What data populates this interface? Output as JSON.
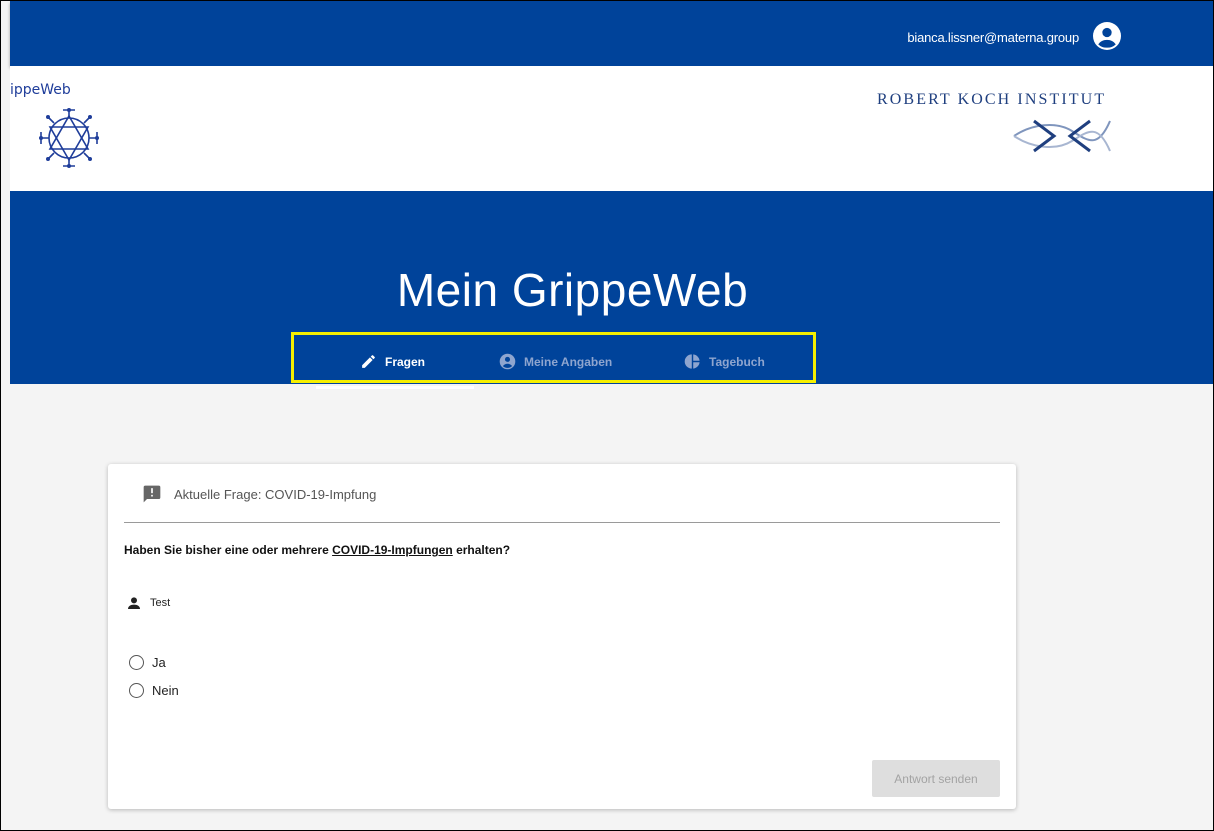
{
  "user": {
    "email": "bianca.lissner@materna.group"
  },
  "logos": {
    "grippeweb_partial": "ippeWeb",
    "rki": "ROBERT KOCH INSTITUT"
  },
  "hero": {
    "title": "Mein GrippeWeb"
  },
  "tabs": [
    {
      "label": "Fragen",
      "icon": "pencil-icon",
      "active": true
    },
    {
      "label": "Meine Angaben",
      "icon": "account-circle-icon",
      "active": false
    },
    {
      "label": "Tagebuch",
      "icon": "pie-chart-icon",
      "active": false
    }
  ],
  "card": {
    "header_label": "Aktuelle Frage: COVID-19-Impfung",
    "question_prefix": "Haben Sie bisher eine oder mehrere ",
    "question_link": "COVID-19-Impfungen",
    "question_suffix": " erhalten?",
    "person_name": "Test",
    "options": [
      "Ja",
      "Nein"
    ],
    "submit_label": "Antwort senden"
  },
  "colors": {
    "brand_blue": "#00439a",
    "highlight_yellow": "#f5ef00",
    "inactive_tab": "#8ea5cf"
  }
}
